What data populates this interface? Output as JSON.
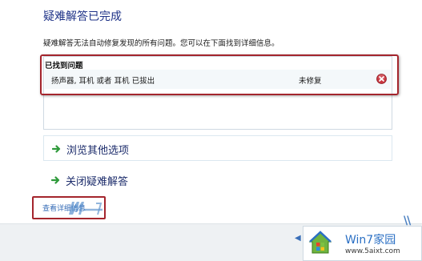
{
  "header": {
    "title": "疑难解答已完成",
    "description": "疑难解答无法自动修复发现的所有问题。您可以在下面找到详细信息。"
  },
  "problems": {
    "header": "已找到问题",
    "items": [
      {
        "name": "扬声器, 耳机 或者 耳机 已拔出",
        "status": "未修复",
        "icon": "error-icon"
      }
    ]
  },
  "options": {
    "browse": "浏览其他选项",
    "close": "关闭疑难解答"
  },
  "details_link": "查看详细信息",
  "watermark": {
    "site_title": "Win7家园",
    "site_url": "www.5aixt.com"
  },
  "colors": {
    "title_blue": "#1e3287",
    "highlight_red": "#a4252d",
    "arrow_green": "#2f9a3b",
    "error_red": "#c8343d"
  }
}
